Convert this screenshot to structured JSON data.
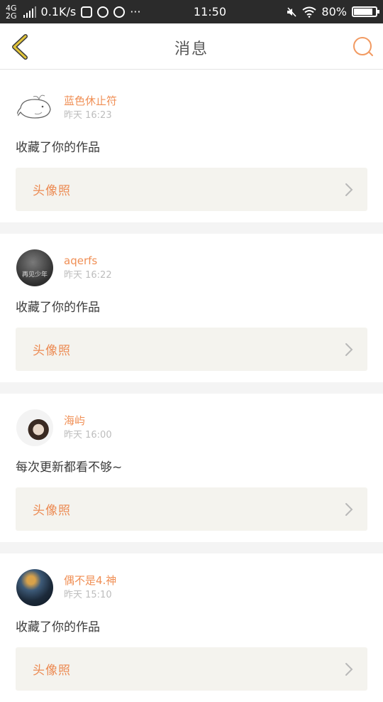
{
  "status": {
    "net_top": "4G",
    "net_bottom": "2G",
    "speed": "0.1K/s",
    "more": "···",
    "time": "11:50",
    "battery": "80%"
  },
  "nav": {
    "title": "消息"
  },
  "messages": [
    {
      "name": "蓝色休止符",
      "time": "昨天 16:23",
      "text": "收藏了你的作品",
      "work": "头像照"
    },
    {
      "name": "aqerfs",
      "time": "昨天 16:22",
      "text": "收藏了你的作品",
      "work": "头像照",
      "avatar_text": "再见少年"
    },
    {
      "name": "海屿",
      "time": "昨天 16:00",
      "text": "每次更新都看不够~",
      "work": "头像照"
    },
    {
      "name": "偶不是4.神",
      "time": "昨天 15:10",
      "text": "收藏了你的作品",
      "work": "头像照"
    }
  ],
  "colors": {
    "accent": "#f08f55",
    "back_icon": "#e2c53a",
    "card_bg": "#f4f3ee"
  },
  "icons": {
    "back": "chevron-left-icon",
    "search": "search-icon",
    "work_arrow": "chevron-right-icon"
  }
}
